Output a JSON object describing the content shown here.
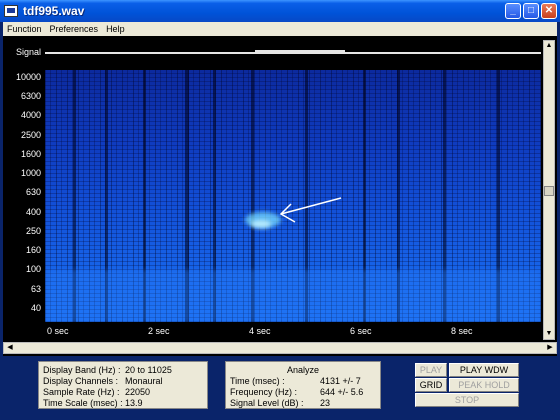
{
  "window": {
    "title": "tdf995.wav"
  },
  "menu": [
    "Function",
    "Preferences",
    "Help"
  ],
  "signal_label": "Signal",
  "freq_labels": [
    "10000",
    "6300",
    "4000",
    "2500",
    "1600",
    "1000",
    "630",
    "400",
    "250",
    "160",
    "100",
    "63",
    "40"
  ],
  "time_labels": [
    "0  sec",
    "2  sec",
    "4  sec",
    "6  sec",
    "8  sec"
  ],
  "display_info": [
    {
      "key": "Display Band (Hz) :",
      "value": "20 to 11025"
    },
    {
      "key": "Display Channels :",
      "value": "Monaural"
    },
    {
      "key": "Sample Rate (Hz) :",
      "value": "22050"
    },
    {
      "key": "Time Scale (msec) :",
      "value": "13.9"
    }
  ],
  "analyze": {
    "title": "Analyze",
    "rows": [
      {
        "key": "Time (msec) :",
        "value": "4131  +/- 7"
      },
      {
        "key": "Frequency (Hz) :",
        "value": "644  +/- 5.6"
      },
      {
        "key": "Signal Level (dB) :",
        "value": "23"
      }
    ]
  },
  "buttons": {
    "play": "PLAY",
    "play_wdw": "PLAY WDW",
    "grid": "GRID",
    "peak_hold": "PEAK HOLD",
    "stop": "STOP"
  },
  "colors": {
    "titlebar": "#0053d8",
    "spectrogram_base": "#1250d8",
    "panel": "#ece9d8"
  }
}
